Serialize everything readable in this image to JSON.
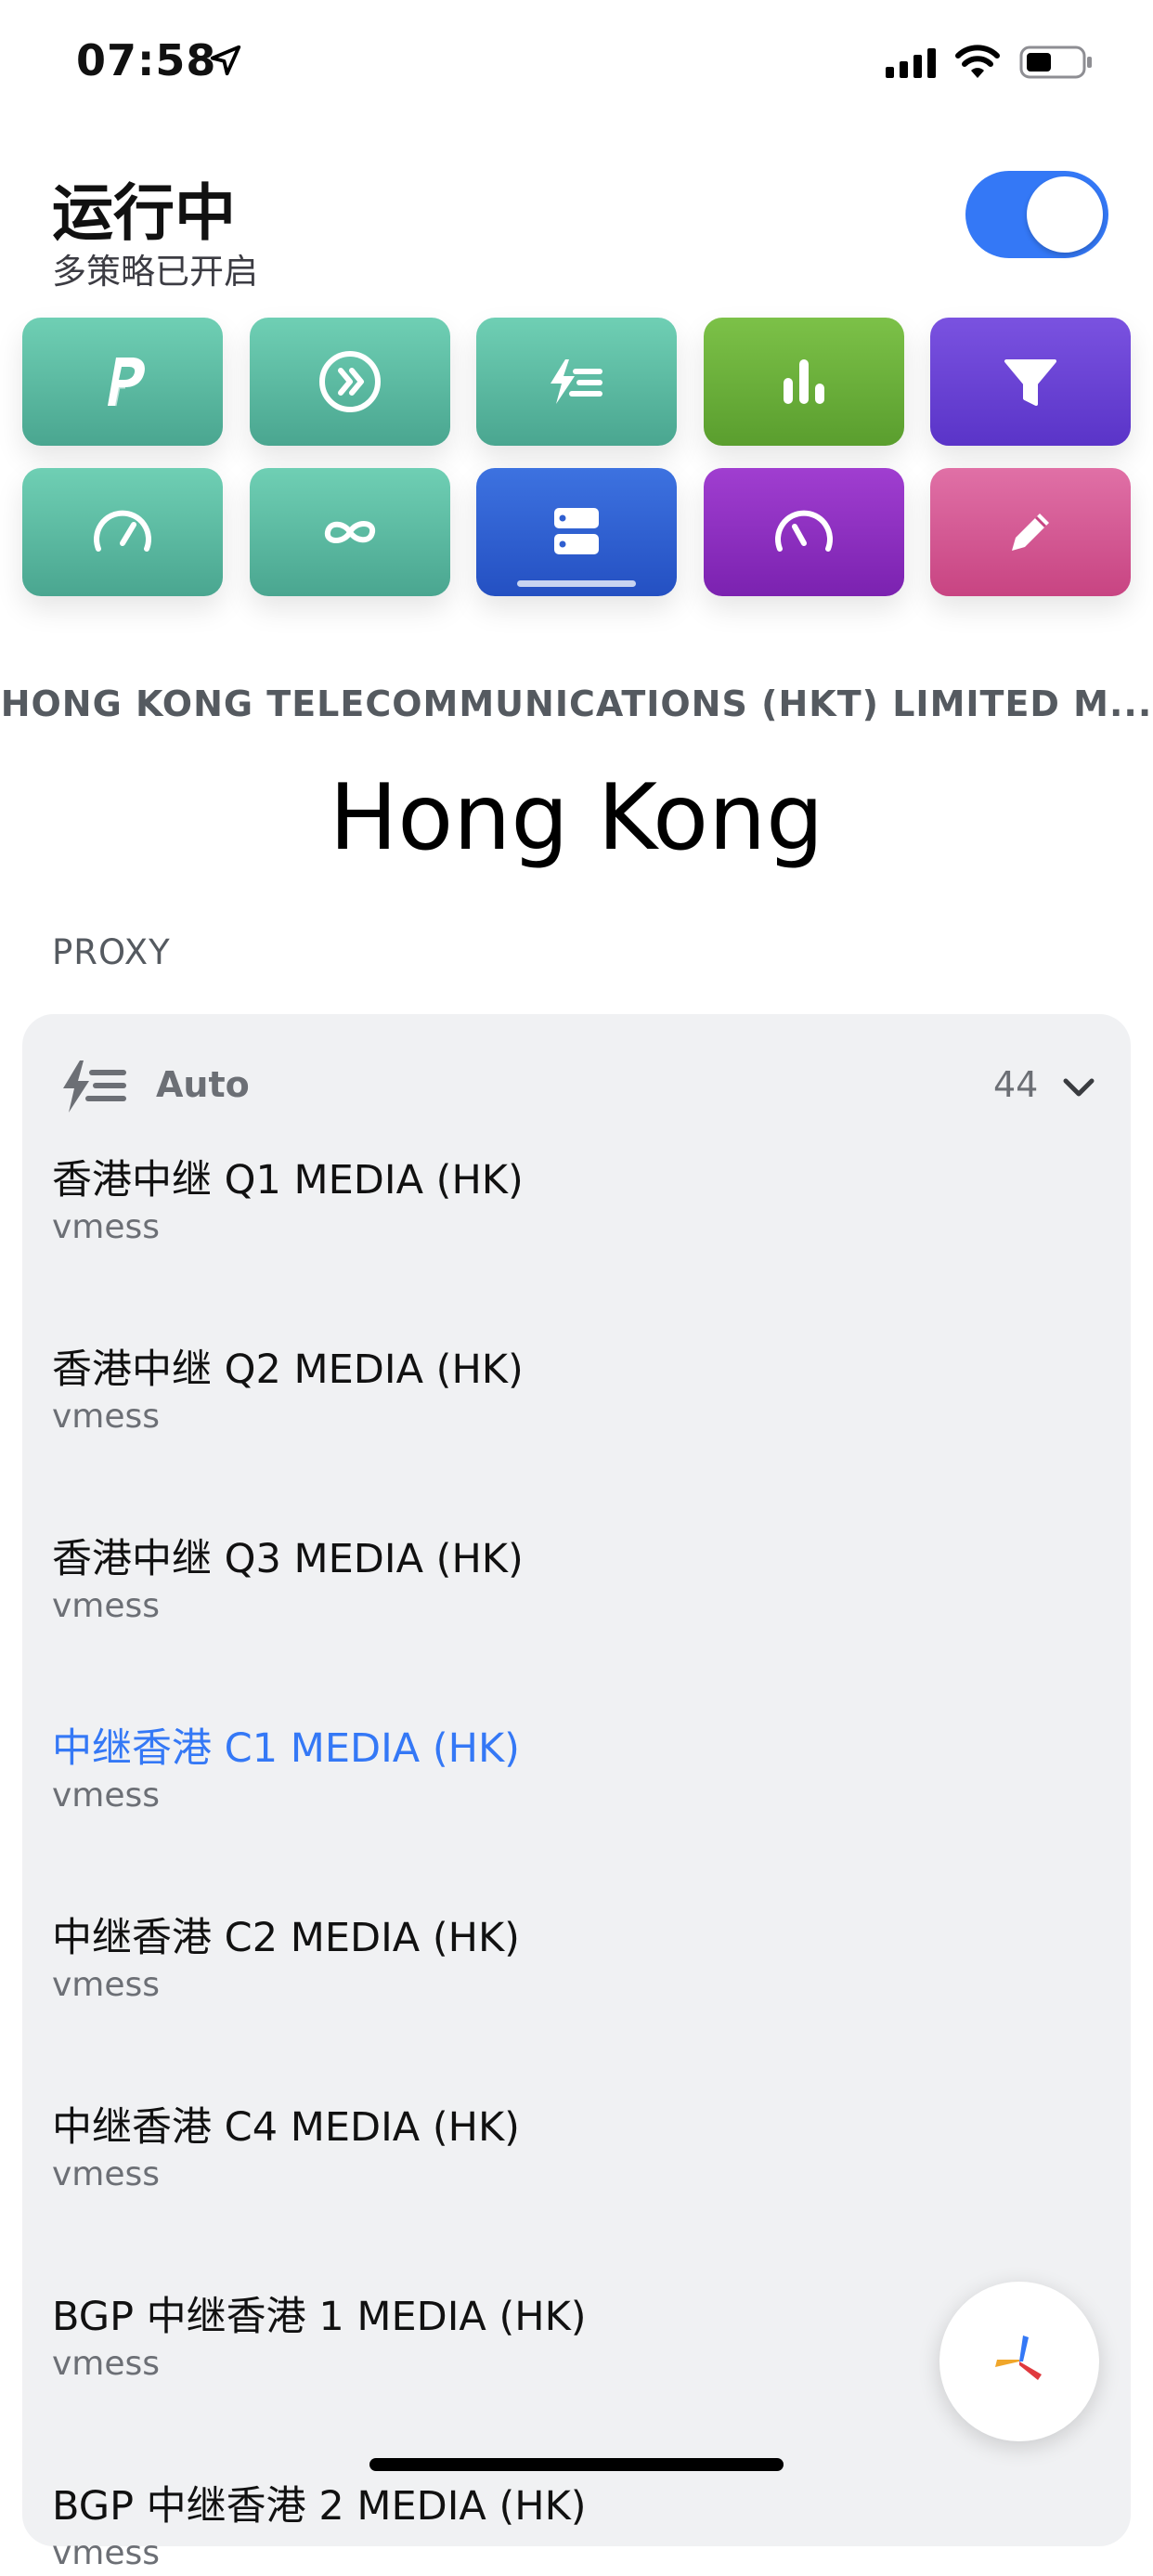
{
  "status_bar": {
    "time": "07:58"
  },
  "header": {
    "title": "运行中",
    "subtitle": "多策略已开启",
    "toggle_on": true
  },
  "tiles": [
    {
      "name": "paypal-icon",
      "color": "#5fbea3"
    },
    {
      "name": "forward-circle-icon",
      "color": "#5fbea3"
    },
    {
      "name": "auto-bolt-icon",
      "color": "#5fbea3"
    },
    {
      "name": "bar-chart-icon",
      "color": "#6cb03c"
    },
    {
      "name": "filter-icon",
      "color": "#6a45d8"
    },
    {
      "name": "speedometer-icon",
      "color": "#5fbea3"
    },
    {
      "name": "infinity-icon",
      "color": "#5fbea3"
    },
    {
      "name": "server-icon",
      "color": "#2f5fd0"
    },
    {
      "name": "gauge-icon",
      "color": "#8a2fc0"
    },
    {
      "name": "pencil-icon",
      "color": "#d64f8a"
    }
  ],
  "location": {
    "isp": "HONG KONG TELECOMMUNICATIONS (HKT) LIMITED M...",
    "city": "Hong Kong"
  },
  "proxy": {
    "section_label": "PROXY",
    "group_name": "Auto",
    "group_count": "44",
    "items": [
      {
        "name": "香港中继 Q1 MEDIA (HK)",
        "type": "vmess",
        "selected": false
      },
      {
        "name": "香港中继 Q2 MEDIA (HK)",
        "type": "vmess",
        "selected": false
      },
      {
        "name": "香港中继 Q3 MEDIA (HK)",
        "type": "vmess",
        "selected": false
      },
      {
        "name": "中继香港 C1 MEDIA (HK)",
        "type": "vmess",
        "selected": true
      },
      {
        "name": "中继香港 C2 MEDIA (HK)",
        "type": "vmess",
        "selected": false
      },
      {
        "name": "中继香港 C4 MEDIA (HK)",
        "type": "vmess",
        "selected": false
      },
      {
        "name": "BGP 中继香港 1 MEDIA (HK)",
        "type": "vmess",
        "selected": false
      },
      {
        "name": "BGP 中继香港 2 MEDIA (HK)",
        "type": "vmess",
        "selected": false
      }
    ]
  },
  "colors": {
    "accent": "#3478f6",
    "card_bg": "#f0f1f3"
  }
}
